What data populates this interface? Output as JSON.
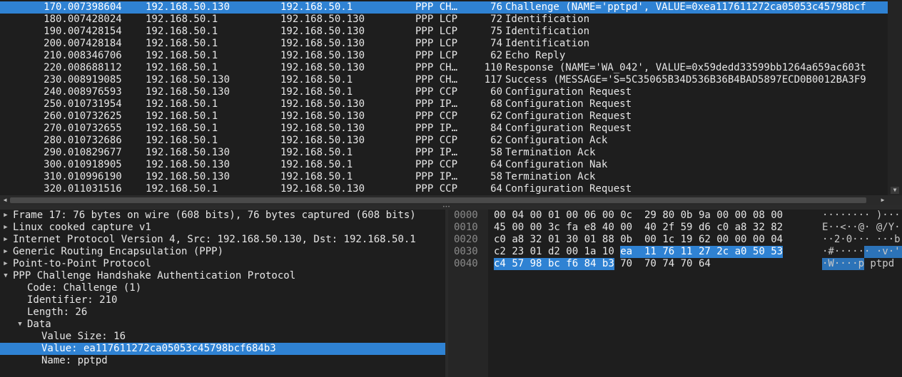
{
  "packets": [
    {
      "no": "17",
      "time": "0.007398604",
      "src": "192.168.50.130",
      "dst": "192.168.50.1",
      "proto": "PPP CH…",
      "len": "76",
      "info": "Challenge (NAME='pptpd', VALUE=0xea117611272ca05053c45798bcf",
      "selected": true
    },
    {
      "no": "18",
      "time": "0.007428024",
      "src": "192.168.50.1",
      "dst": "192.168.50.130",
      "proto": "PPP LCP",
      "len": "72",
      "info": "Identification"
    },
    {
      "no": "19",
      "time": "0.007428154",
      "src": "192.168.50.1",
      "dst": "192.168.50.130",
      "proto": "PPP LCP",
      "len": "75",
      "info": "Identification"
    },
    {
      "no": "20",
      "time": "0.007428184",
      "src": "192.168.50.1",
      "dst": "192.168.50.130",
      "proto": "PPP LCP",
      "len": "74",
      "info": "Identification"
    },
    {
      "no": "21",
      "time": "0.008346706",
      "src": "192.168.50.1",
      "dst": "192.168.50.130",
      "proto": "PPP LCP",
      "len": "62",
      "info": "Echo Reply"
    },
    {
      "no": "22",
      "time": "0.008688112",
      "src": "192.168.50.1",
      "dst": "192.168.50.130",
      "proto": "PPP CH…",
      "len": "110",
      "info": "Response (NAME='WA_042', VALUE=0x59dedd33599bb1264a659ac603t"
    },
    {
      "no": "23",
      "time": "0.008919085",
      "src": "192.168.50.130",
      "dst": "192.168.50.1",
      "proto": "PPP CH…",
      "len": "117",
      "info": "Success (MESSAGE='S=5C35065B34D536B36B4BAD5897ECD0B0012BA3F9"
    },
    {
      "no": "24",
      "time": "0.008976593",
      "src": "192.168.50.130",
      "dst": "192.168.50.1",
      "proto": "PPP CCP",
      "len": "60",
      "info": "Configuration Request"
    },
    {
      "no": "25",
      "time": "0.010731954",
      "src": "192.168.50.1",
      "dst": "192.168.50.130",
      "proto": "PPP IP…",
      "len": "68",
      "info": "Configuration Request"
    },
    {
      "no": "26",
      "time": "0.010732625",
      "src": "192.168.50.1",
      "dst": "192.168.50.130",
      "proto": "PPP CCP",
      "len": "62",
      "info": "Configuration Request"
    },
    {
      "no": "27",
      "time": "0.010732655",
      "src": "192.168.50.1",
      "dst": "192.168.50.130",
      "proto": "PPP IP…",
      "len": "84",
      "info": "Configuration Request"
    },
    {
      "no": "28",
      "time": "0.010732686",
      "src": "192.168.50.1",
      "dst": "192.168.50.130",
      "proto": "PPP CCP",
      "len": "62",
      "info": "Configuration Ack"
    },
    {
      "no": "29",
      "time": "0.010829677",
      "src": "192.168.50.130",
      "dst": "192.168.50.1",
      "proto": "PPP IP…",
      "len": "58",
      "info": "Termination Ack"
    },
    {
      "no": "30",
      "time": "0.010918905",
      "src": "192.168.50.130",
      "dst": "192.168.50.1",
      "proto": "PPP CCP",
      "len": "64",
      "info": "Configuration Nak"
    },
    {
      "no": "31",
      "time": "0.010996190",
      "src": "192.168.50.130",
      "dst": "192.168.50.1",
      "proto": "PPP IP…",
      "len": "58",
      "info": "Termination Ack"
    },
    {
      "no": "32",
      "time": "0.011031516",
      "src": "192.168.50.1",
      "dst": "192.168.50.130",
      "proto": "PPP CCP",
      "len": "64",
      "info": "Configuration Request"
    }
  ],
  "details": [
    {
      "level": 0,
      "toggle": "collapsed",
      "text": "Frame 17: 76 bytes on wire (608 bits), 76 bytes captured (608 bits)"
    },
    {
      "level": 0,
      "toggle": "collapsed",
      "text": "Linux cooked capture v1"
    },
    {
      "level": 0,
      "toggle": "collapsed",
      "text": "Internet Protocol Version 4, Src: 192.168.50.130, Dst: 192.168.50.1"
    },
    {
      "level": 0,
      "toggle": "collapsed",
      "text": "Generic Routing Encapsulation (PPP)"
    },
    {
      "level": 0,
      "toggle": "collapsed",
      "text": "Point-to-Point Protocol"
    },
    {
      "level": 0,
      "toggle": "expanded",
      "text": "PPP Challenge Handshake Authentication Protocol"
    },
    {
      "level": 1,
      "toggle": "none",
      "text": "Code: Challenge (1)"
    },
    {
      "level": 1,
      "toggle": "none",
      "text": "Identifier: 210"
    },
    {
      "level": 1,
      "toggle": "none",
      "text": "Length: 26"
    },
    {
      "level": 1,
      "toggle": "expanded",
      "text": "Data"
    },
    {
      "level": 2,
      "toggle": "none",
      "text": "Value Size: 16"
    },
    {
      "level": 2,
      "toggle": "none",
      "text": "Value: ea117611272ca05053c45798bcf684b3",
      "selected": true
    },
    {
      "level": 2,
      "toggle": "none",
      "text": "Name: pptpd"
    }
  ],
  "bytes": [
    {
      "offset": "0000",
      "hex": [
        "00",
        "04",
        "00",
        "01",
        "00",
        "06",
        "00",
        "0c",
        "29",
        "80",
        "0b",
        "9a",
        "00",
        "00",
        "08",
        "00"
      ],
      "ascii": "········ )···"
    },
    {
      "offset": "0010",
      "hex": [
        "45",
        "00",
        "00",
        "3c",
        "fa",
        "e8",
        "40",
        "00",
        "40",
        "2f",
        "59",
        "d6",
        "c0",
        "a8",
        "32",
        "82"
      ],
      "ascii": "E··<··@· @/Y···2·"
    },
    {
      "offset": "0020",
      "hex": [
        "c0",
        "a8",
        "32",
        "01",
        "30",
        "01",
        "88",
        "0b",
        "00",
        "1c",
        "19",
        "62",
        "00",
        "00",
        "00",
        "04"
      ],
      "ascii": "··2·0··· ···b····"
    },
    {
      "offset": "0030",
      "hex": [
        "c2",
        "23",
        "01",
        "d2",
        "00",
        "1a",
        "10",
        "ea",
        "11",
        "76",
        "11",
        "27",
        "2c",
        "a0",
        "50",
        "53"
      ],
      "ascii": "·#······ ·v·',·PS"
    },
    {
      "offset": "0040",
      "hex": [
        "c4",
        "57",
        "98",
        "bc",
        "f6",
        "84",
        "b3",
        "70",
        "70",
        "74",
        "70",
        "64"
      ],
      "ascii": "·W····p ptpd"
    }
  ],
  "bytes_highlight": {
    "start": 55,
    "end": 70
  },
  "highlight_color": "#2f82d3",
  "icons": {
    "collapsed": "triangle-right",
    "expanded": "triangle-down"
  }
}
